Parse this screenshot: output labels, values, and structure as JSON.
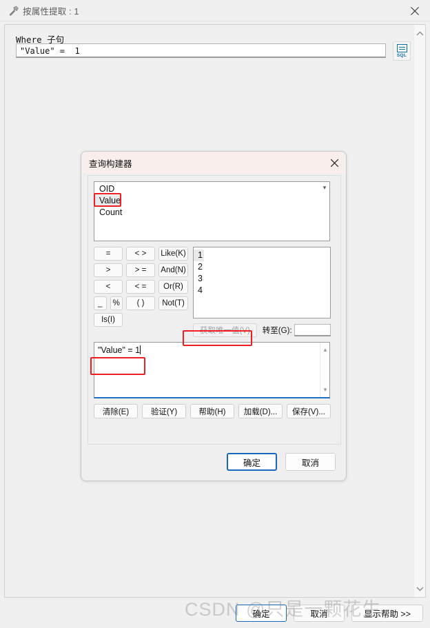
{
  "window": {
    "title": "按属性提取 : 1",
    "icon": "hammer-icon",
    "close_icon": "close-icon"
  },
  "where_clause": {
    "label": "Where 子句",
    "value": "\"Value\" =  1",
    "sql_button_label": "SQL"
  },
  "query_builder": {
    "title": "查询构建器",
    "close_icon": "close-icon",
    "fields": [
      {
        "label": "OID",
        "selected": false
      },
      {
        "label": "Value",
        "selected": true
      },
      {
        "label": "Count",
        "selected": false
      }
    ],
    "operators": [
      [
        {
          "label": "=",
          "width": "op-w1"
        },
        {
          "label": "< >",
          "width": "op-w2"
        },
        {
          "label": "Like(K)",
          "width": "op-w3"
        }
      ],
      [
        {
          "label": ">",
          "width": "op-w1"
        },
        {
          "label": "> =",
          "width": "op-w2"
        },
        {
          "label": "And(N)",
          "width": "op-w3"
        }
      ],
      [
        {
          "label": "<",
          "width": "op-w1"
        },
        {
          "label": "< =",
          "width": "op-w2"
        },
        {
          "label": "Or(R)",
          "width": "op-w3"
        }
      ],
      [
        {
          "label": "_",
          "width": "op-half"
        },
        {
          "label": "%",
          "width": "op-half"
        },
        {
          "label": "( )",
          "width": "op-w2"
        },
        {
          "label": "Not(T)",
          "width": "op-w3"
        }
      ],
      [
        {
          "label": "Is(I)",
          "width": "op-w1"
        }
      ]
    ],
    "values": [
      {
        "label": "1",
        "selected": true
      },
      {
        "label": "2",
        "selected": false
      },
      {
        "label": "3",
        "selected": false
      },
      {
        "label": "4",
        "selected": false
      }
    ],
    "unique_values_button": "获取唯一值(V)",
    "unique_values_disabled": true,
    "goto_label": "转至(G):",
    "goto_value": "",
    "expression": "\"Value\" = 1",
    "actions": [
      "清除(E)",
      "验证(Y)",
      "帮助(H)",
      "加载(D)...",
      "保存(V)..."
    ],
    "footer": {
      "ok": "确定",
      "cancel": "取消"
    }
  },
  "window_footer": {
    "ok": "确定",
    "cancel": "取消",
    "show_help": "显示帮助 >>"
  },
  "watermark": "CSDN @只是一颗花生",
  "colors": {
    "annotation_red": "#f01e1e",
    "accent_blue": "#1668bd",
    "dialog_title_bg": "#f8efec"
  }
}
